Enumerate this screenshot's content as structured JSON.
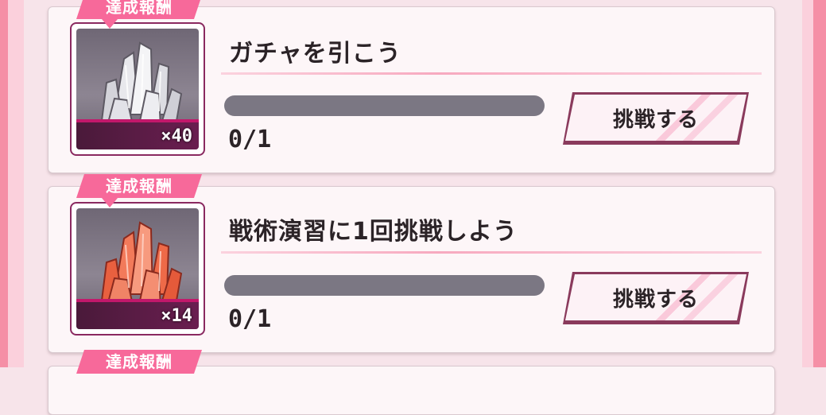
{
  "missions": [
    {
      "badge": "達成報酬",
      "reward_icon": "white-crystal-icon",
      "reward_color": "#e8e8ec",
      "quantity": "×40",
      "title": "ガチャを引こう",
      "progress_fraction": 0,
      "count": "0/1",
      "button_label": "挑戦する"
    },
    {
      "badge": "達成報酬",
      "reward_icon": "red-crystal-icon",
      "reward_color": "#f27a5a",
      "quantity": "×14",
      "title": "戦術演習に1回挑戦しよう",
      "progress_fraction": 0,
      "count": "0/1",
      "button_label": "挑戦する"
    },
    {
      "badge": "達成報酬"
    }
  ],
  "colors": {
    "accent": "#f7699a",
    "frame": "#f58fa6",
    "progress_track": "#7b7783"
  }
}
